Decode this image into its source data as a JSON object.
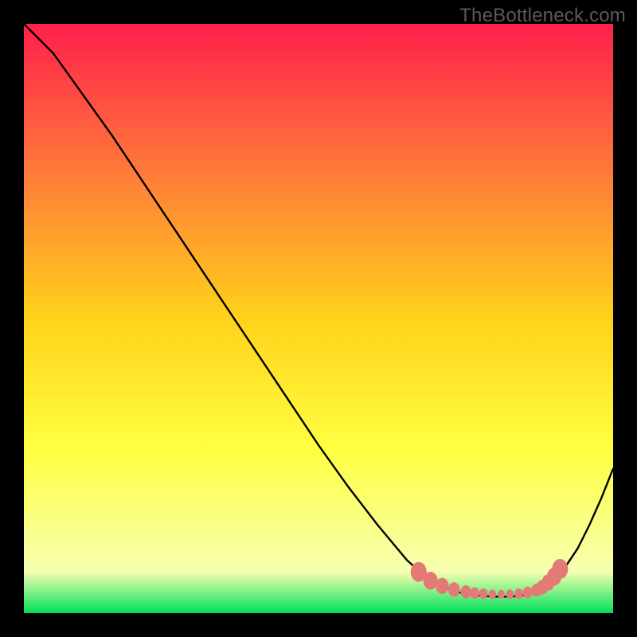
{
  "watermark": "TheBottleneck.com",
  "chart_data": {
    "type": "line",
    "title": "",
    "xlabel": "",
    "ylabel": "",
    "xlim": [
      0,
      100
    ],
    "ylim": [
      0,
      100
    ],
    "grid": false,
    "legend": false,
    "background_gradient": {
      "top_color": "#ff1f4b",
      "upper_mid_color": "#ff7a3a",
      "mid_color": "#ffd21a",
      "lower_mid_color": "#ffff40",
      "near_bottom_color": "#f6ffb0",
      "bottom_color": "#00e05a"
    },
    "series": [
      {
        "name": "bottleneck-curve",
        "color": "#000000",
        "x": [
          0,
          3,
          5,
          10,
          15,
          20,
          25,
          30,
          35,
          40,
          45,
          50,
          55,
          60,
          65,
          68,
          70,
          72,
          74,
          76,
          78,
          80,
          82,
          84,
          86,
          88,
          90,
          92,
          94,
          96,
          98,
          100
        ],
        "y": [
          100,
          97,
          95,
          88,
          81,
          73.5,
          66,
          58.5,
          51,
          43.5,
          36,
          28.5,
          21.5,
          15,
          9,
          6.3,
          5,
          4.1,
          3.5,
          3.1,
          2.9,
          2.8,
          2.8,
          2.9,
          3.3,
          4.2,
          5.7,
          8,
          11,
          15,
          19.5,
          24.5
        ]
      }
    ],
    "optimal_zone": {
      "name": "optimal-dotted-band",
      "color": "#e47a76",
      "x": [
        67,
        69,
        71,
        73,
        75,
        76.5,
        78,
        79.5,
        81,
        82.5,
        84,
        85.5,
        87,
        88,
        89,
        90,
        91
      ],
      "y": [
        7.0,
        5.5,
        4.6,
        4.0,
        3.6,
        3.4,
        3.3,
        3.2,
        3.2,
        3.2,
        3.3,
        3.5,
        3.9,
        4.4,
        5.2,
        6.2,
        7.5
      ]
    }
  }
}
